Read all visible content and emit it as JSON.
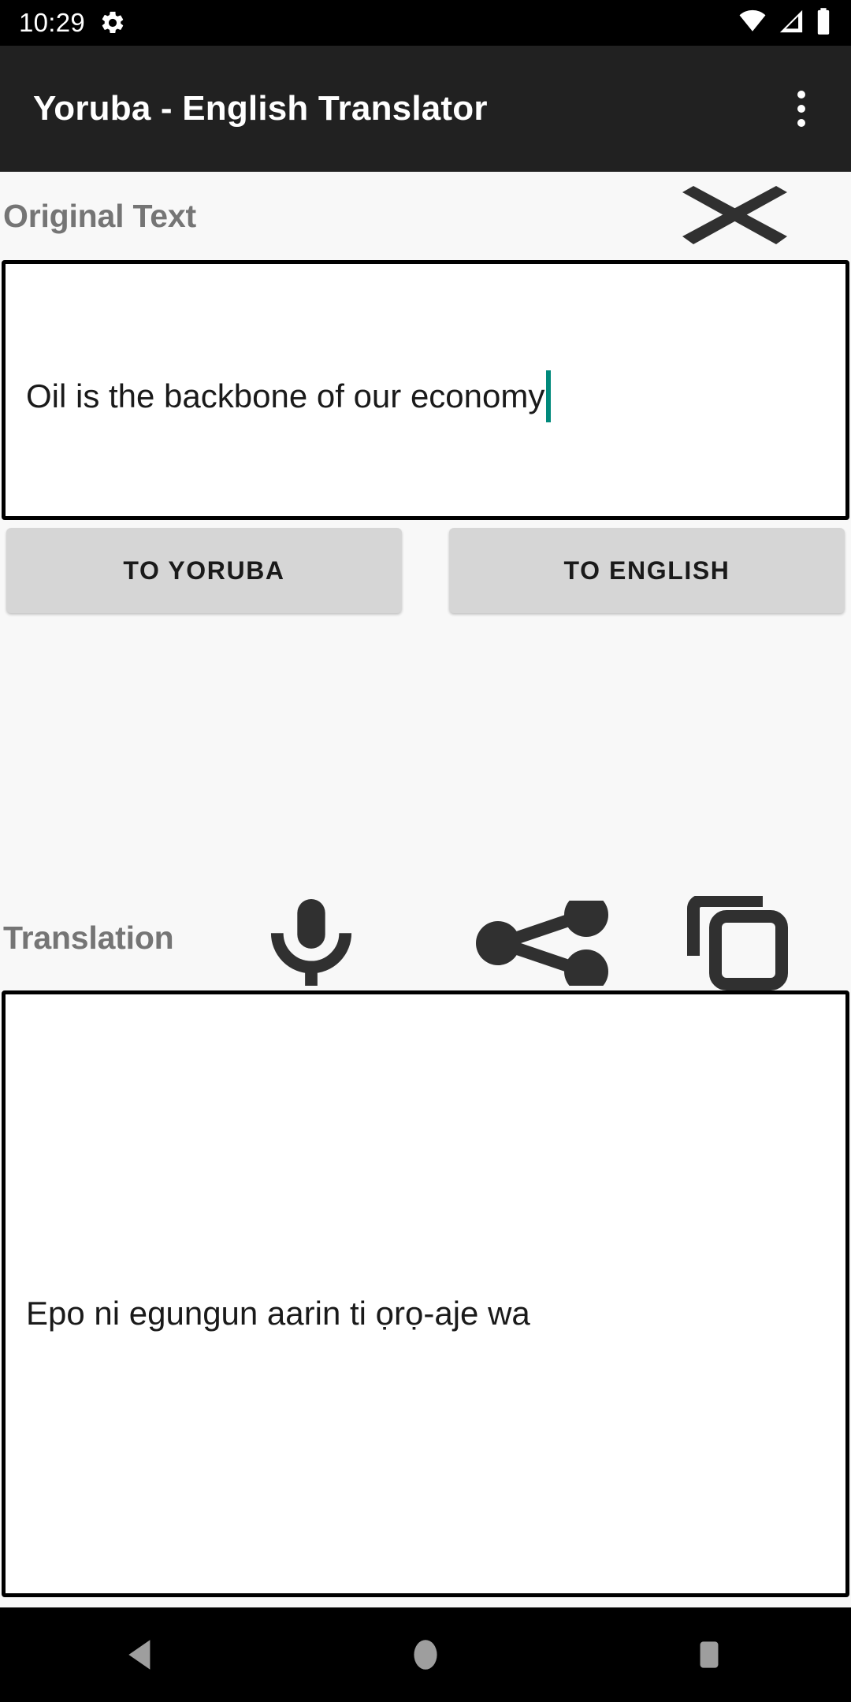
{
  "status_bar": {
    "time": "10:29",
    "icons": [
      "gear-icon",
      "wifi-icon",
      "cellular-signal-icon",
      "battery-icon"
    ]
  },
  "app_bar": {
    "title": "Yoruba - English Translator",
    "overflow_menu": "more-options-icon"
  },
  "original_section": {
    "label": "Original Text",
    "clear_icon": "clear-x-icon",
    "input_value": "Oil is the backbone of our economy",
    "input_placeholder": "",
    "caret_color": "#00897b"
  },
  "actions": {
    "to_yoruba_label": "TO YORUBA",
    "to_english_label": "TO ENGLISH",
    "button_color": "#d6d6d6"
  },
  "translation_section": {
    "label": "Translation",
    "icons": [
      "microphone-icon",
      "share-icon",
      "copy-icon"
    ],
    "output_value": "Epo ni egungun aarin ti ọrọ-aje wa"
  },
  "nav_bar": {
    "back": "back-icon",
    "home": "home-icon",
    "recents": "recents-icon",
    "color": "#9e9e9e"
  },
  "colors": {
    "status_bar_bg": "#000000",
    "app_bar_bg": "#212121",
    "page_bg": "#f8f8f8",
    "label_text": "#757575",
    "box_border": "#000000",
    "icon_dark": "#303030"
  }
}
